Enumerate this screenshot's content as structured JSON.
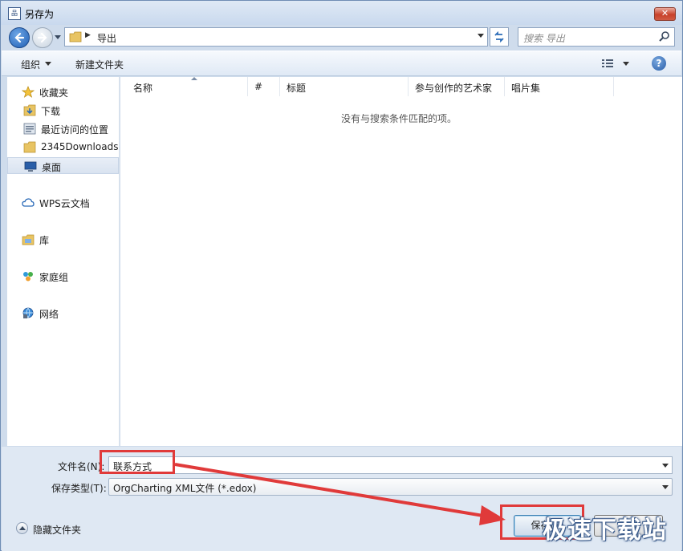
{
  "window": {
    "title": "另存为",
    "close_label": "✕"
  },
  "nav": {
    "current_folder": "导出",
    "search_placeholder": "搜索 导出"
  },
  "toolbar": {
    "organize_label": "组织",
    "new_folder_label": "新建文件夹",
    "help_label": "?"
  },
  "sidebar": {
    "items": [
      {
        "label": "收藏夹",
        "icon": "star-icon",
        "kind": "top"
      },
      {
        "label": "下载",
        "icon": "download-folder-icon",
        "kind": "child"
      },
      {
        "label": "最近访问的位置",
        "icon": "recent-places-icon",
        "kind": "child"
      },
      {
        "label": "2345Downloads",
        "icon": "folder-icon",
        "kind": "child"
      },
      {
        "label": "桌面",
        "icon": "desktop-icon",
        "kind": "child",
        "selected": true
      },
      {
        "label": "WPS云文档",
        "icon": "cloud-icon",
        "kind": "group"
      },
      {
        "label": "库",
        "icon": "library-icon",
        "kind": "group"
      },
      {
        "label": "家庭组",
        "icon": "homegroup-icon",
        "kind": "group"
      },
      {
        "label": "网络",
        "icon": "network-icon",
        "kind": "group"
      }
    ]
  },
  "filelist": {
    "columns": [
      "名称",
      "#",
      "标题",
      "参与创作的艺术家",
      "唱片集"
    ],
    "empty_message": "没有与搜索条件匹配的项。"
  },
  "form": {
    "filename_label": "文件名(N):",
    "filename_value": "联系方式",
    "filetype_label": "保存类型(T):",
    "filetype_value": "OrgCharting XML文件 (*.edox)"
  },
  "footer": {
    "hide_folders_label": "隐藏文件夹",
    "save_label": "保存(S)",
    "cancel_label": "取消"
  },
  "watermark": "极速下载站",
  "colors": {
    "annotation": "#e03a3a",
    "window_frame": "#cfdcec",
    "accent": "#3c7fb1"
  }
}
